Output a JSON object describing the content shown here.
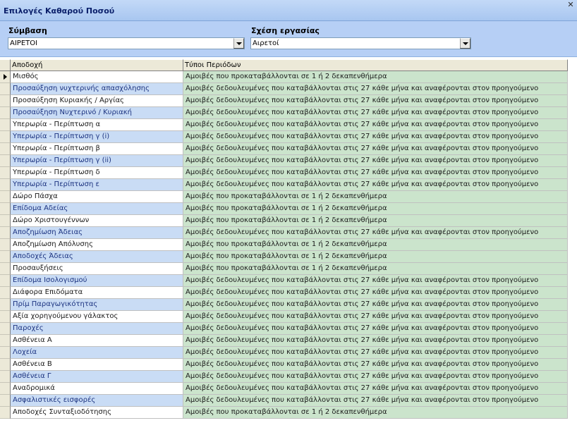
{
  "window": {
    "title": "Επιλογές Καθαρού Ποσού",
    "close_glyph": "✕"
  },
  "filters": {
    "contract": {
      "label": "Σύμβαση",
      "value": "ΑΙΡΕΤΟΙ"
    },
    "employment": {
      "label": "Σχέση εργασίας",
      "value": "Αιρετοί"
    }
  },
  "grid": {
    "columns": [
      "Αποδοχή",
      "Τύποι Περιόδων"
    ],
    "selected_row": 0,
    "rows": [
      {
        "name": "Μισθός",
        "period": "Αμοιβές που προκαταβάλλονται σε 1 ή 2 δεκαπενθήμερα"
      },
      {
        "name": "Προσαύξηση νυχτερινής απασχόλησης",
        "period": "Αμοιβές δεδουλευμένες που καταβάλλονται στις 27 κάθε μήνα και αναφέρονται στον προηγούμενο"
      },
      {
        "name": "Προσαύξηση Κυριακής / Αργίας",
        "period": "Αμοιβές δεδουλευμένες που καταβάλλονται στις 27 κάθε μήνα και αναφέρονται στον προηγούμενο"
      },
      {
        "name": "Προσαύξηση Νυχτερινό / Κυριακή",
        "period": "Αμοιβές δεδουλευμένες που καταβάλλονται στις 27 κάθε μήνα και αναφέρονται στον προηγούμενο"
      },
      {
        "name": "Υπερωρία - Περίπτωση α",
        "period": "Αμοιβές δεδουλευμένες που καταβάλλονται στις 27 κάθε μήνα και αναφέρονται στον προηγούμενο"
      },
      {
        "name": "Υπερωρία - Περίπτωση γ (i)",
        "period": "Αμοιβές δεδουλευμένες που καταβάλλονται στις 27 κάθε μήνα και αναφέρονται στον προηγούμενο"
      },
      {
        "name": "Υπερωρία - Περίπτωση β",
        "period": "Αμοιβές δεδουλευμένες που καταβάλλονται στις 27 κάθε μήνα και αναφέρονται στον προηγούμενο"
      },
      {
        "name": "Υπερωρία - Περίπτωση γ (ii)",
        "period": "Αμοιβές δεδουλευμένες που καταβάλλονται στις 27 κάθε μήνα και αναφέρονται στον προηγούμενο"
      },
      {
        "name": "Υπερωρία - Περίπτωση δ",
        "period": "Αμοιβές δεδουλευμένες που καταβάλλονται στις 27 κάθε μήνα και αναφέρονται στον προηγούμενο"
      },
      {
        "name": "Υπερωρία - Περίπτωση ε",
        "period": "Αμοιβές δεδουλευμένες που καταβάλλονται στις 27 κάθε μήνα και αναφέρονται στον προηγούμενο"
      },
      {
        "name": "Δώρο Πάσχα",
        "period": "Αμοιβές που προκαταβάλλονται σε 1 ή 2 δεκαπενθήμερα"
      },
      {
        "name": "Επίδομα Αδείας",
        "period": "Αμοιβές που προκαταβάλλονται σε 1 ή 2 δεκαπενθήμερα"
      },
      {
        "name": "Δώρο Χριστουγέννων",
        "period": "Αμοιβές που προκαταβάλλονται σε 1 ή 2 δεκαπενθήμερα"
      },
      {
        "name": "Αποζημίωση Άδειας",
        "period": "Αμοιβές δεδουλευμένες που καταβάλλονται στις 27 κάθε μήνα και αναφέρονται στον προηγούμενο"
      },
      {
        "name": "Αποζημίωση Απόλυσης",
        "period": "Αμοιβές που προκαταβάλλονται σε 1 ή 2 δεκαπενθήμερα"
      },
      {
        "name": "Αποδοχές Άδειας",
        "period": "Αμοιβές που προκαταβάλλονται σε 1 ή 2 δεκαπενθήμερα"
      },
      {
        "name": "Προσαυξήσεις",
        "period": "Αμοιβές που προκαταβάλλονται σε 1 ή 2 δεκαπενθήμερα"
      },
      {
        "name": "Επίδομα Ισολογισμού",
        "period": "Αμοιβές δεδουλευμένες που καταβάλλονται στις 27 κάθε μήνα και αναφέρονται στον προηγούμενο"
      },
      {
        "name": "Διάφορα Επιδόματα",
        "period": "Αμοιβές δεδουλευμένες που καταβάλλονται στις 27 κάθε μήνα και αναφέρονται στον προηγούμενο"
      },
      {
        "name": "Πρίμ Παραγωγικότητας",
        "period": "Αμοιβές δεδουλευμένες που καταβάλλονται στις 27 κάθε μήνα και αναφέρονται στον προηγούμενο"
      },
      {
        "name": "Αξία χορηγούμενου γάλακτος",
        "period": "Αμοιβές δεδουλευμένες που καταβάλλονται στις 27 κάθε μήνα και αναφέρονται στον προηγούμενο"
      },
      {
        "name": "Παροχές",
        "period": "Αμοιβές δεδουλευμένες που καταβάλλονται στις 27 κάθε μήνα και αναφέρονται στον προηγούμενο"
      },
      {
        "name": "Ασθένεια Α",
        "period": "Αμοιβές δεδουλευμένες που καταβάλλονται στις 27 κάθε μήνα και αναφέρονται στον προηγούμενο"
      },
      {
        "name": "Λοχεία",
        "period": "Αμοιβές δεδουλευμένες που καταβάλλονται στις 27 κάθε μήνα και αναφέρονται στον προηγούμενο"
      },
      {
        "name": "Ασθένεια Β",
        "period": "Αμοιβές δεδουλευμένες που καταβάλλονται στις 27 κάθε μήνα και αναφέρονται στον προηγούμενο"
      },
      {
        "name": "Ασθένεια Γ",
        "period": "Αμοιβές δεδουλευμένες που καταβάλλονται στις 27 κάθε μήνα και αναφέρονται στον προηγούμενο"
      },
      {
        "name": "Αναδρομικά",
        "period": "Αμοιβές δεδουλευμένες που καταβάλλονται στις 27 κάθε μήνα και αναφέρονται στον προηγούμενο"
      },
      {
        "name": "Ασφαλιστικές εισφορές",
        "period": "Αμοιβές δεδουλευμένες που καταβάλλονται στις 27 κάθε μήνα και αναφέρονται στον προηγούμενο"
      },
      {
        "name": "Αποδοχές Συνταξιοδότησης",
        "period": "Αμοιβές που προκαταβάλλονται σε 1 ή 2 δεκαπενθήμερα"
      }
    ]
  },
  "colors": {
    "titlebar": "#a8c6f0",
    "filterbar": "#b6cff5",
    "alt_row": "#c9dcf5",
    "period_cell": "#cbe4cc"
  }
}
